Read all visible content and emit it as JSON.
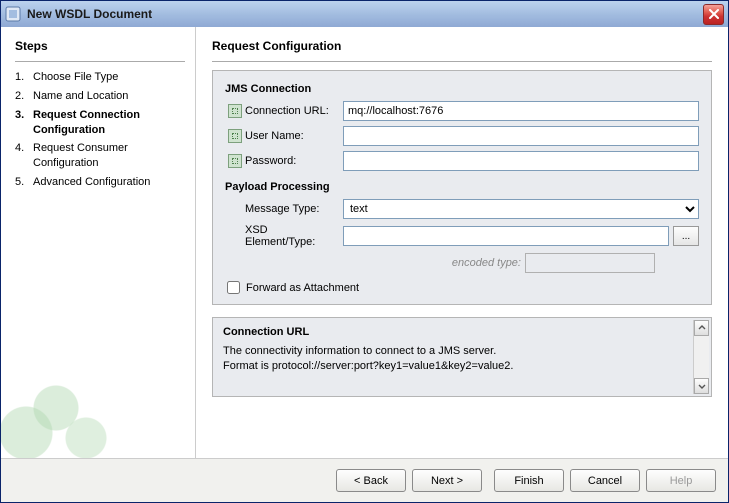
{
  "window": {
    "title": "New WSDL Document"
  },
  "sidebar": {
    "heading": "Steps",
    "items": [
      {
        "num": "1.",
        "label": "Choose File Type"
      },
      {
        "num": "2.",
        "label": "Name and Location"
      },
      {
        "num": "3.",
        "label": "Request Connection Configuration",
        "current": true
      },
      {
        "num": "4.",
        "label": "Request Consumer Configuration"
      },
      {
        "num": "5.",
        "label": "Advanced Configuration"
      }
    ]
  },
  "main": {
    "title": "Request Configuration",
    "jms": {
      "group_label": "JMS Connection",
      "url_label": "Connection URL:",
      "url_value": "mq://localhost:7676",
      "user_label": "User Name:",
      "user_value": "",
      "pass_label": "Password:",
      "pass_value": ""
    },
    "payload": {
      "group_label": "Payload Processing",
      "msgtype_label": "Message Type:",
      "msgtype_value": "text",
      "xsd_label": "XSD Element/Type:",
      "xsd_value": "",
      "encoded_label": "encoded type:",
      "encoded_value": "",
      "forward_label": "Forward as Attachment",
      "forward_checked": false,
      "browse_label": "..."
    }
  },
  "help": {
    "title": "Connection URL",
    "line1": "The connectivity information to connect to a JMS server.",
    "line2": "Format is protocol://server:port?key1=value1&key2=value2."
  },
  "buttons": {
    "back": "< Back",
    "next": "Next >",
    "finish": "Finish",
    "cancel": "Cancel",
    "help": "Help"
  }
}
